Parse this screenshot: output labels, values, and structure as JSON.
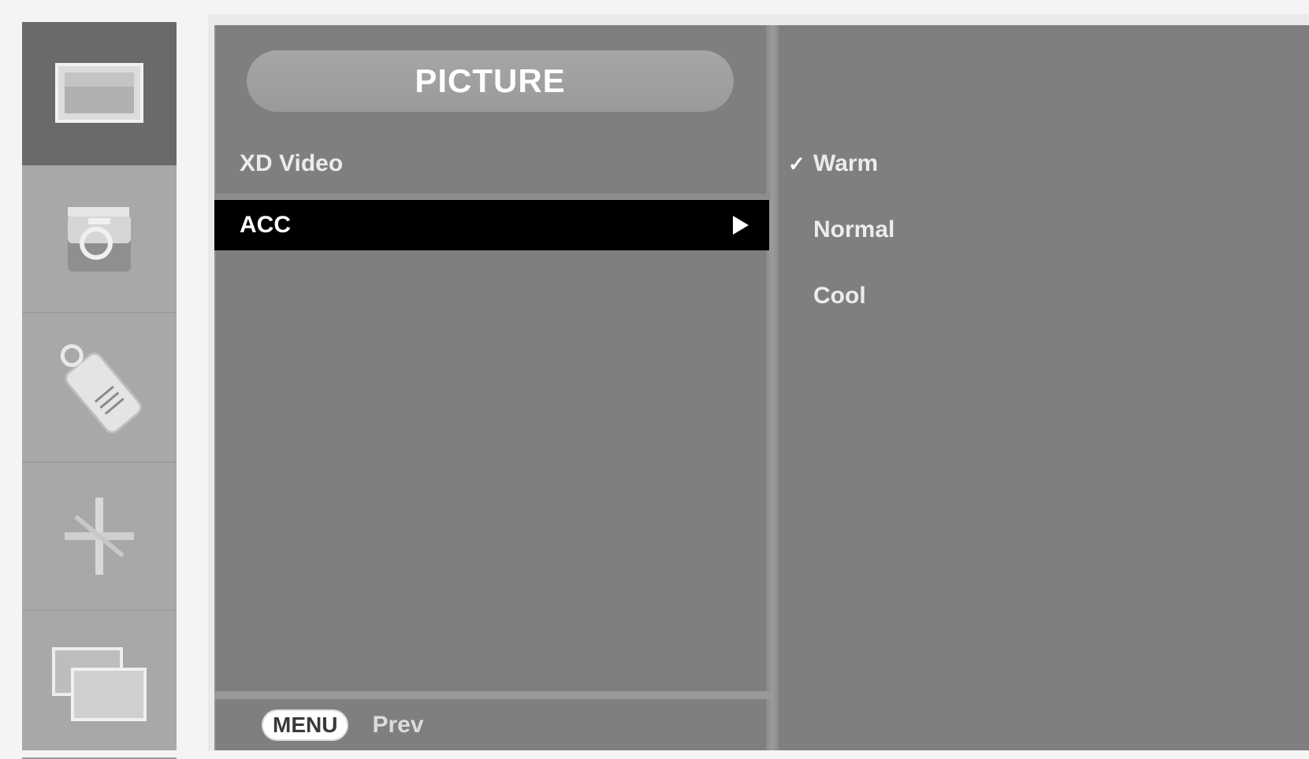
{
  "sidebar": {
    "items": [
      {
        "icon": "monitor-icon",
        "active": true
      },
      {
        "icon": "color-settings-icon",
        "active": false
      },
      {
        "icon": "tag-icon",
        "active": false
      },
      {
        "icon": "tracking-cross-icon",
        "active": false
      },
      {
        "icon": "pip-screens-icon",
        "active": false
      }
    ]
  },
  "menu": {
    "title": "PICTURE",
    "items": [
      {
        "label": "XD Video",
        "selected": false
      },
      {
        "label": "ACC",
        "selected": true
      }
    ]
  },
  "submenu": {
    "options": [
      {
        "label": "Warm",
        "checked": true
      },
      {
        "label": "Normal",
        "checked": false
      },
      {
        "label": "Cool",
        "checked": false
      }
    ],
    "check_symbol": "✓"
  },
  "footer": {
    "key_label": "MENU",
    "action_label": "Prev"
  },
  "colors": {
    "panel": "#7f7f7f",
    "sidebar": "#a8a8a8",
    "selected_row": "#000000",
    "text": "#ececec"
  }
}
